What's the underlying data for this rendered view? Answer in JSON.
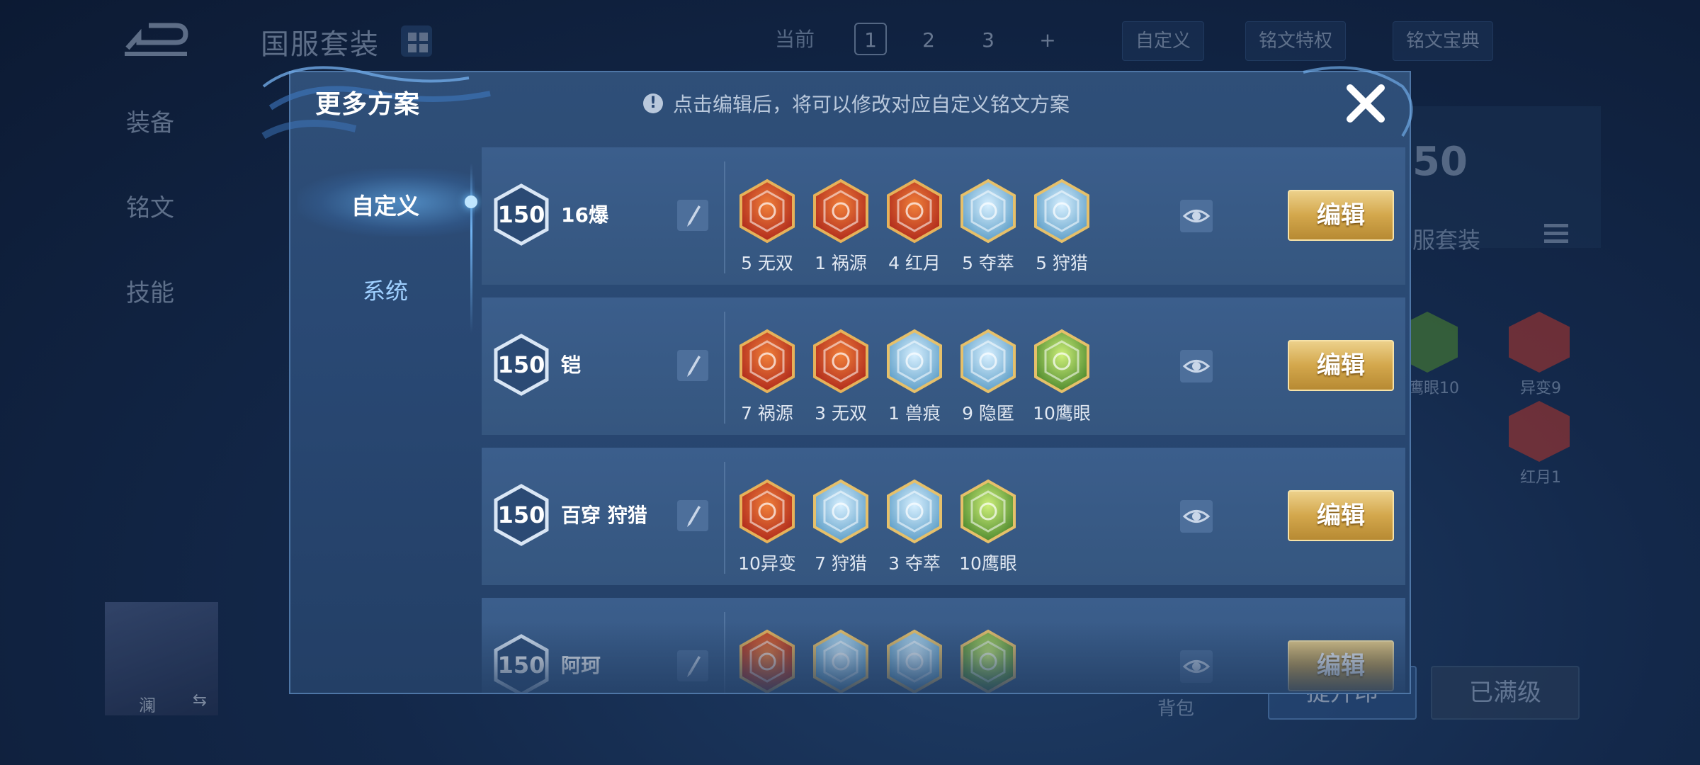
{
  "background": {
    "title": "国服套装",
    "left_menu": [
      "装备",
      "铭文",
      "技能"
    ],
    "plan_label": "当前",
    "plans": [
      "1",
      "2",
      "3",
      "+"
    ],
    "custom_label": "自定义",
    "privilege_label": "铭文特权",
    "codex_label": "铭文宝典",
    "level_badge": "50",
    "suit_label": "服套装",
    "side_runes": [
      {
        "label": "鹰眼10",
        "color": "#4f8a2e"
      },
      {
        "label": "异变9",
        "color": "#b6372c"
      },
      {
        "label": "红月1",
        "color": "#b6372c"
      }
    ],
    "hero_name": "澜",
    "bag_label": "背包",
    "upgrade_label": "提升印",
    "maxed_label": "已满级"
  },
  "modal": {
    "title": "更多方案",
    "hint": "点击编辑后，将可以修改对应自定义铭文方案",
    "tabs": [
      {
        "label": "自定义",
        "active": true
      },
      {
        "label": "系统",
        "active": false
      }
    ],
    "edit_label": "编辑",
    "rows": [
      {
        "level": "150",
        "name": "16爆",
        "runes": [
          {
            "label": "5 无双",
            "color": "red"
          },
          {
            "label": "1 祸源",
            "color": "red"
          },
          {
            "label": "4 红月",
            "color": "red"
          },
          {
            "label": "5 夺萃",
            "color": "blue"
          },
          {
            "label": "5 狩猎",
            "color": "blue"
          }
        ]
      },
      {
        "level": "150",
        "name": "铠",
        "runes": [
          {
            "label": "7 祸源",
            "color": "red"
          },
          {
            "label": "3 无双",
            "color": "red"
          },
          {
            "label": "1 兽痕",
            "color": "blue"
          },
          {
            "label": "9 隐匿",
            "color": "blue"
          },
          {
            "label": "10鹰眼",
            "color": "green"
          }
        ]
      },
      {
        "level": "150",
        "name": "百穿 狩猎",
        "runes": [
          {
            "label": "10异变",
            "color": "red"
          },
          {
            "label": "7 狩猎",
            "color": "blue"
          },
          {
            "label": "3 夺萃",
            "color": "blue"
          },
          {
            "label": "10鹰眼",
            "color": "green"
          }
        ]
      },
      {
        "level": "150",
        "name": "阿珂",
        "runes": [
          {
            "label": "",
            "color": "red"
          },
          {
            "label": "",
            "color": "blue"
          },
          {
            "label": "",
            "color": "blue"
          },
          {
            "label": "",
            "color": "green"
          }
        ]
      }
    ]
  },
  "colors": {
    "rune_red": "#c2432a",
    "rune_blue": "#7fb9d8",
    "rune_green": "#7fb04a",
    "gold": "#d3a74c",
    "accent_blue": "#6fc3ff"
  }
}
